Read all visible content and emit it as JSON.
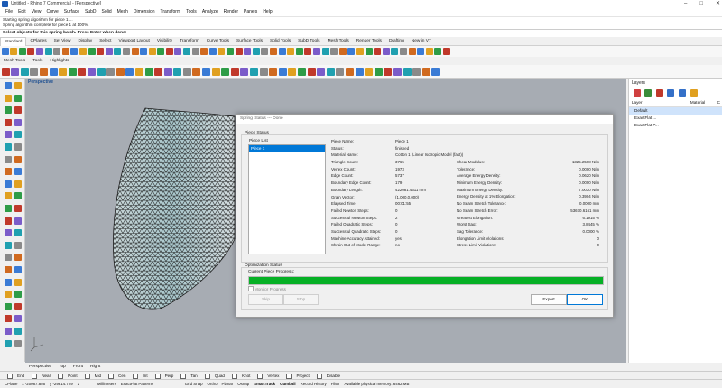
{
  "window": {
    "title": "Untitled - Rhino 7 Commercial - [Perspective]"
  },
  "menu": [
    "File",
    "Edit",
    "View",
    "Curve",
    "Surface",
    "SubD",
    "Solid",
    "Mesh",
    "Dimension",
    "Transform",
    "Tools",
    "Analyze",
    "Render",
    "Panels",
    "Help"
  ],
  "command_history": [
    "Starting spring algorithm for piece 1 ...",
    "Spring algorithm complete for piece 1 at 100%."
  ],
  "command_prompt": "Select objects for this spring batch. Press Enter when done:",
  "toolbar_tabs": [
    "Standard",
    "CPlanes",
    "Set View",
    "Display",
    "Select",
    "Viewport Layout",
    "Visibility",
    "Transform",
    "Curve Tools",
    "Surface Tools",
    "Solid Tools",
    "SubD Tools",
    "Mesh Tools",
    "Render Tools",
    "Drafting",
    "New in V7"
  ],
  "toolbar_tabs2": [
    "Mesh Tools",
    "Tools",
    "Highlights"
  ],
  "viewport": {
    "title": "Perspective"
  },
  "viewport_tabs": [
    "Perspective",
    "Top",
    "Front",
    "Right"
  ],
  "layers": {
    "title": "Layers",
    "columns": [
      "Layer",
      "Material",
      "C"
    ],
    "rows": [
      {
        "name": "Default",
        "selected": true
      },
      {
        "name": "ExactFlat ...",
        "selected": false
      },
      {
        "name": "ExactFlat P...",
        "selected": false
      }
    ]
  },
  "dialog": {
    "title": "Spring Status --- Done",
    "piece_status_label": "Piece Status",
    "piece_list_label": "Piece List",
    "piece_list": [
      "Piece 1"
    ],
    "left_labels": [
      "Piece Name:",
      "Status:",
      "Material Name:",
      "Triangle Count:",
      "Vertex Count:",
      "Edge Count:",
      "Boundary Edge Count:",
      "Boundary Length:",
      "Grain Vector:",
      "Elapsed Time:",
      "Failed Newton Steps:",
      "Successful Newton Steps:",
      "Failed Quadratic Steps:",
      "Successful Quadratic Steps:",
      "Machine Accuracy Attained:",
      "Shrain Out of Model Range:"
    ],
    "left_values": [
      "Piece 1",
      "finished",
      "Cotton 1 (Linear Isotropic Model (fast))",
      "3765",
      "1973",
      "5737",
      "179",
      "422081.4311 mm",
      "(1.000,0.000)",
      "00:01:55",
      "0",
      "2",
      "0",
      "0",
      "yes",
      "no"
    ],
    "right_labels": [
      "Shear Modulus:",
      "Tolerance:",
      "Average Energy Density:",
      "Minimum Energy Density:",
      "Maximum Energy Density:",
      "Energy Density at 1% Elongation:",
      "No Seam Stretch Tolerance:",
      "No Seam Stretch Error:",
      "Greatest Elongation:",
      "Worst Sag:",
      "Sag Tolerance:",
      "Elongation Limit Violations:",
      "Stress Limit Violations:"
    ],
    "right_values": [
      "1325.2508 N/m",
      "0.0000 N/m",
      "0.0620 N/m",
      "0.0000 N/m",
      "7.0030 N/m",
      "0.3904 N/m",
      "0.0000 mm",
      "53670.6161 mm",
      "6.1915 %",
      "3.8445 %",
      "0.0000 %",
      "0",
      "0"
    ],
    "optimization_label": "Optimization Status",
    "progress_label": "Current Piece Progress:",
    "progress_fraction": 1.0,
    "monitor_label": "Monitor Progress",
    "skip_label": "Skip",
    "stop_label": "Stop",
    "export_label": "Export",
    "ok_label": "OK",
    "progress_color": "#06b025"
  },
  "osnap": [
    "End",
    "Near",
    "Point",
    "Mid",
    "Cen",
    "Int",
    "Perp",
    "Tan",
    "Quad",
    "Knot",
    "Vertex",
    "Project",
    "Disable"
  ],
  "status": {
    "cplane": "CPlane",
    "x": "x -20087.856",
    "y": "y -29814.729",
    "z": "z",
    "units": "Millimeters",
    "layer": "ExactFlat Patterns",
    "items": [
      "Grid Snap",
      "Ortho",
      "Planar",
      "Osnap",
      "SmartTrack",
      "Gumball",
      "Record History",
      "Filter"
    ],
    "memory": "Available physical memory: 6462 MB"
  }
}
